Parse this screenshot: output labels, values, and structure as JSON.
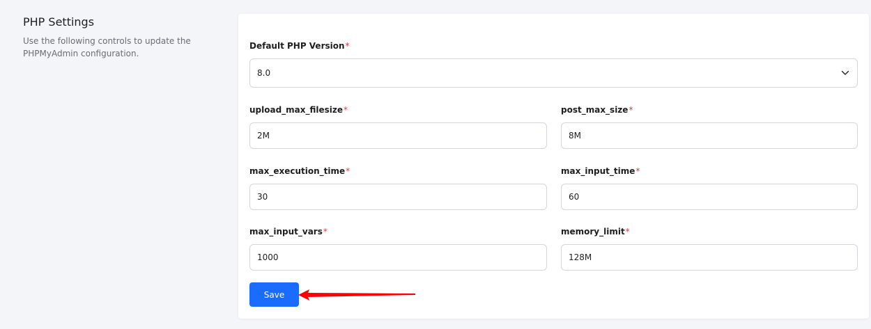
{
  "section": {
    "title": "PHP Settings",
    "description": "Use the following controls to update the PHPMyAdmin configuration."
  },
  "form": {
    "php_version": {
      "label": "Default PHP Version",
      "value": "8.0"
    },
    "upload_max_filesize": {
      "label": "upload_max_filesize",
      "value": "2M"
    },
    "post_max_size": {
      "label": "post_max_size",
      "value": "8M"
    },
    "max_execution_time": {
      "label": "max_execution_time",
      "value": "30"
    },
    "max_input_time": {
      "label": "max_input_time",
      "value": "60"
    },
    "max_input_vars": {
      "label": "max_input_vars",
      "value": "1000"
    },
    "memory_limit": {
      "label": "memory_limit",
      "value": "128M"
    },
    "required_marker": "*",
    "save_label": "Save"
  },
  "icons": {
    "select_chevron": "chevron-down-icon",
    "annotation": "red-arrow-icon"
  },
  "colors": {
    "accent": "#1a6cff",
    "required": "#e0343f",
    "annotation": "#ff0000"
  }
}
